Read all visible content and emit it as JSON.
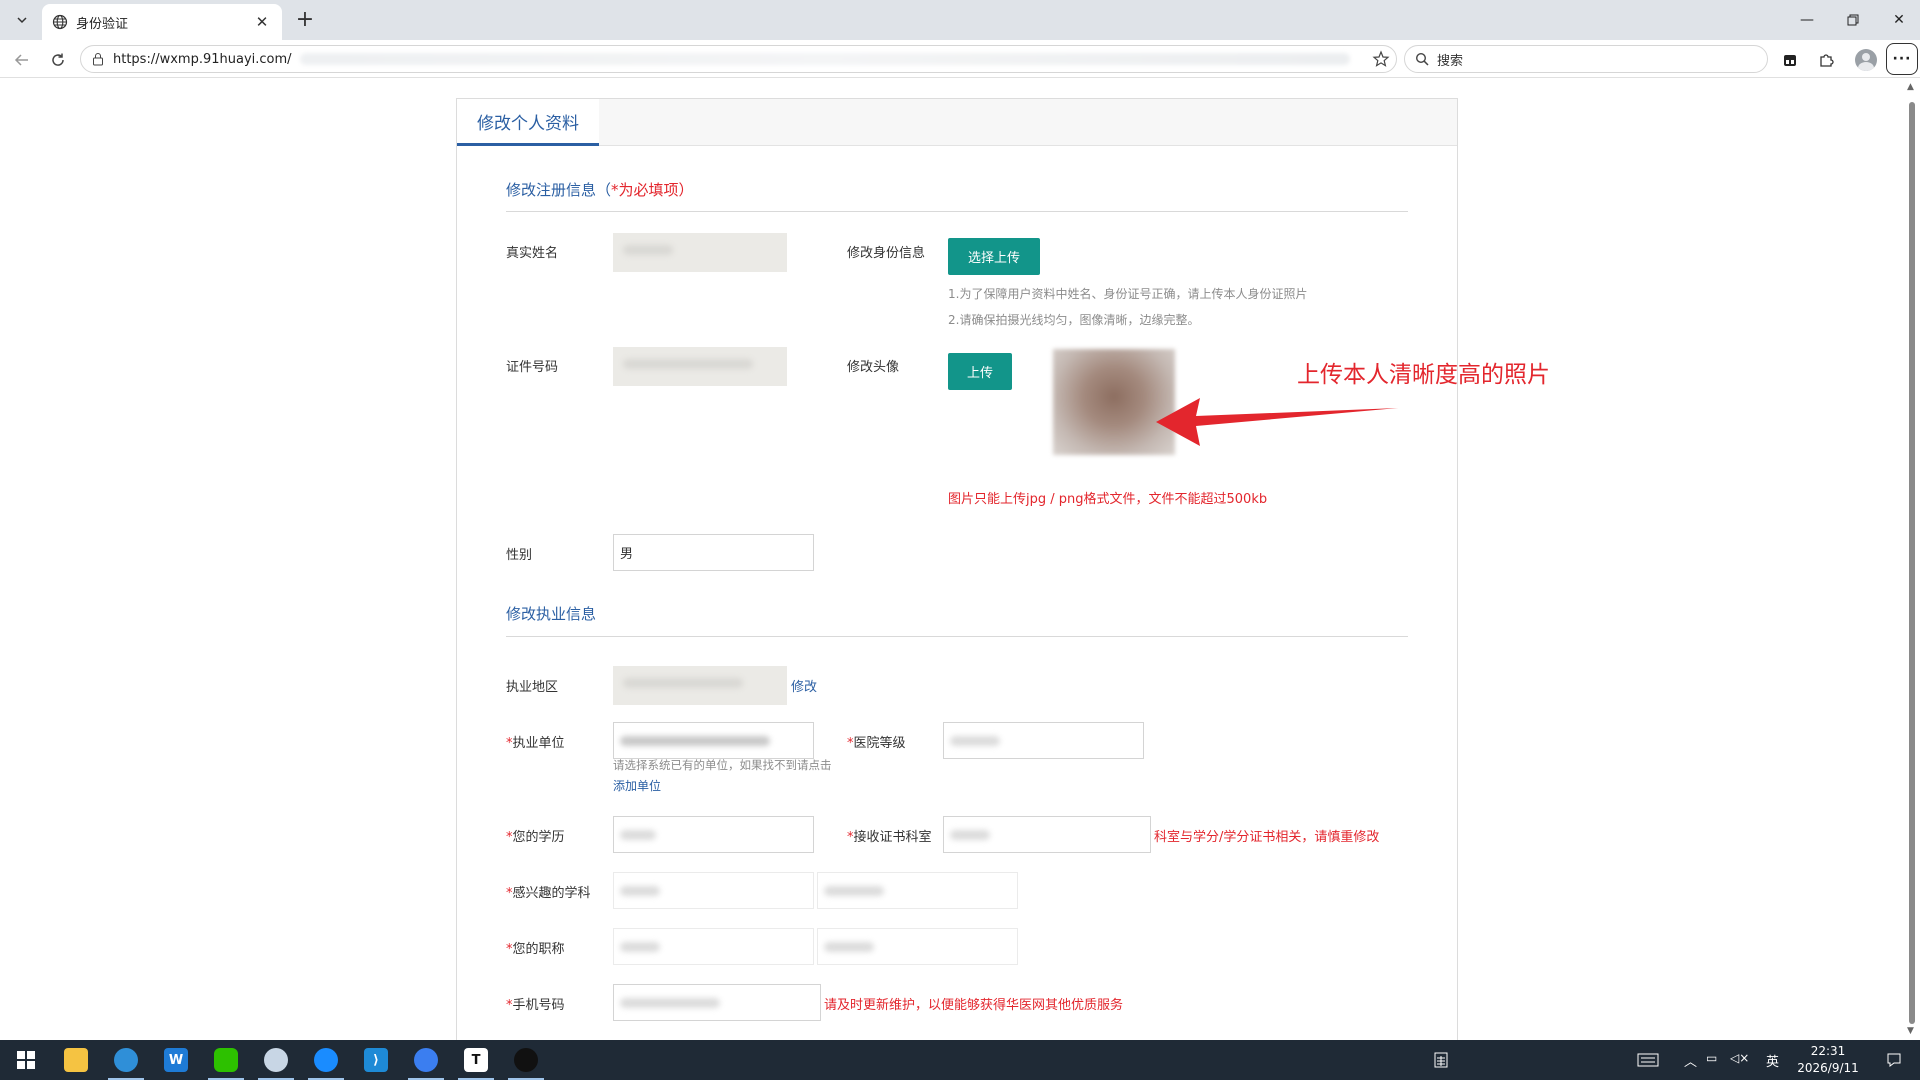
{
  "browser": {
    "tab_title": "身份验证",
    "url": "https://wxmp.91huayi.com/",
    "search_placeholder": "搜索"
  },
  "page": {
    "panel_tab": "修改个人资料",
    "registration": {
      "section_title": "修改注册信息（",
      "section_title_req": "*为必填项）",
      "real_name_label": "真实姓名",
      "id_number_label": "证件号码",
      "identity_label": "修改身份信息",
      "identity_button": "选择上传",
      "identity_hint_1": "1.为了保障用户资料中姓名、身份证号正确，请上传本人身份证照片",
      "identity_hint_2": "2.请确保拍摄光线均匀，图像清晰，边缘完整。",
      "avatar_label": "修改头像",
      "avatar_button": "上传",
      "avatar_note": "图片只能上传jpg / png格式文件，文件不能超过500kb",
      "gender_label": "性别",
      "gender_value": "男"
    },
    "annotation": "上传本人清晰度高的照片",
    "practice": {
      "section_title": "修改执业信息",
      "region_label": "执业地区",
      "region_edit_link": "修改",
      "unit_label": "执业单位",
      "unit_hint": "请选择系统已有的单位，如果找不到请点击",
      "add_unit_link": "添加单位",
      "hospital_level_label": "医院等级",
      "education_label": "您的学历",
      "dept_label": "接收证书科室",
      "dept_note": "科室与学分/学分证书相关，请慎重修改",
      "subject_label": "感兴趣的学科",
      "title_label": "您的职称",
      "phone_label": "手机号码",
      "phone_note": "请及时更新维护，以便能够获得华医网其他优质服务",
      "required_mark": "*"
    }
  },
  "taskbar": {
    "ime": "英",
    "time": "22:31",
    "date": "2026/9/11"
  },
  "colors": {
    "accent_blue": "#2b5fa3",
    "teal_button": "#12958a",
    "required_red": "#e3262d",
    "taskbar": "#1f2a36"
  },
  "icons": [
    "tab-list-icon",
    "globe-icon",
    "close-icon",
    "new-tab-icon",
    "minimize-icon",
    "restore-icon",
    "window-close-icon",
    "back-icon",
    "reload-icon",
    "lock-icon",
    "star-icon",
    "search-icon",
    "collections-icon",
    "extensions-icon",
    "profile-icon",
    "more-icon",
    "arrow-icon",
    "windows-start-icon",
    "file-explorer-icon",
    "edge-icon",
    "word-icon",
    "wechat-icon",
    "paint-icon",
    "browser-icon",
    "vscode-icon",
    "chrome-icon",
    "typora-icon",
    "qq-icon",
    "calculator-icon",
    "keyboard-icon",
    "chevron-up-icon",
    "network-icon",
    "speaker-icon",
    "notification-icon"
  ]
}
